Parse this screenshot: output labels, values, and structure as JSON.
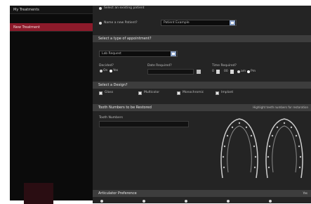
{
  "sidebar": {
    "items": [
      {
        "label": "My Treatments"
      },
      {
        "label": "New Treatment"
      }
    ]
  },
  "form": {
    "existing_patient_label": "Select an existing patient",
    "new_patient_label": "Name a new Patient?",
    "patient_name_value": "Patient Example",
    "appointment_header": "Select a type of appointment?",
    "appointment_value": "Lab Request",
    "decision_label": "Decided?",
    "decision_yes": "On",
    "decision_no": "Yes",
    "date_label": "Date Required?",
    "time_label": "Time Required?",
    "time_am": "am",
    "time_pm": "Pm",
    "design_header": "Select a Design?",
    "design_options": [
      "Glass",
      "Multicolor",
      "Monochromic",
      "Implant"
    ],
    "teeth_header": "Tooth Numbers to be Restored",
    "teeth_hint": "Highlight teeth numbers for restoration",
    "teeth_field_label": "Tooth Numbers",
    "articulator_header": "Articulator Preference",
    "articulator_badge": "Yes"
  },
  "colors": {
    "sidebar_active": "#8c1a2a",
    "panel_bg": "#242424",
    "header_bar": "#3d3d3d"
  }
}
